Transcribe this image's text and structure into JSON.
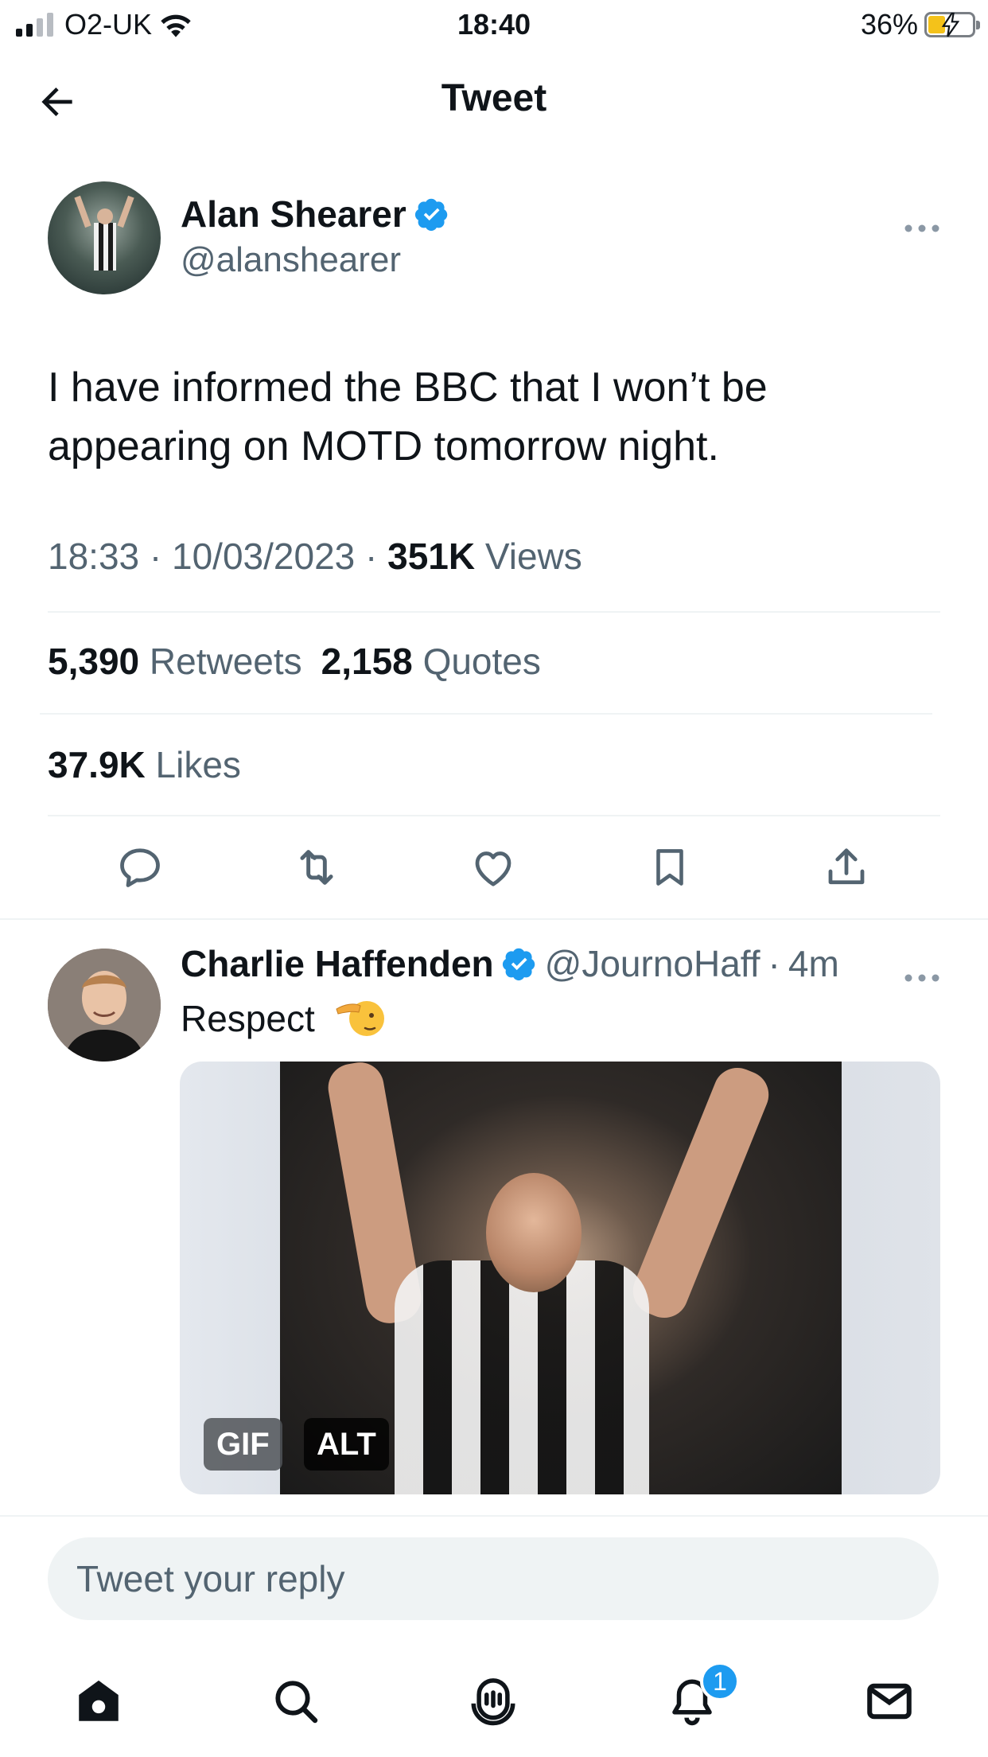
{
  "status_bar": {
    "carrier": "O2-UK",
    "time": "18:40",
    "battery_percent": "36%",
    "signal_bars_active": 2,
    "signal_bars_total": 4,
    "battery_level": 0.36,
    "charging": true
  },
  "header": {
    "title": "Tweet",
    "back_icon": "arrow-left-icon"
  },
  "tweet": {
    "author_name": "Alan Shearer",
    "author_handle": "@alanshearer",
    "verified": true,
    "text": "I have informed the BBC that I won’t be appearing on MOTD tomorrow night.",
    "time": "18:33",
    "date": "10/03/2023",
    "views_count": "351K",
    "views_label": "Views",
    "retweets_count": "5,390",
    "retweets_label": "Retweets",
    "quotes_count": "2,158",
    "quotes_label": "Quotes",
    "likes_count": "37.9K",
    "likes_label": "Likes",
    "separator": "·",
    "more_icon": "more-horizontal-icon"
  },
  "actions": [
    "reply-icon",
    "retweet-icon",
    "like-icon",
    "bookmark-icon",
    "share-icon"
  ],
  "reply": {
    "author_name": "Charlie Haffenden",
    "author_handle": "@JournoHaff",
    "time_ago": "4m",
    "separator": "·",
    "verified": true,
    "text": "Respect",
    "emoji": "saluting-face-emoji",
    "media": {
      "gif_label": "GIF",
      "alt_label": "ALT"
    }
  },
  "composer": {
    "placeholder": "Tweet your reply"
  },
  "tab_bar": {
    "tabs": [
      "home-icon",
      "search-icon",
      "spaces-icon",
      "notifications-icon",
      "messages-icon"
    ],
    "notifications_badge": "1"
  },
  "colors": {
    "accent": "#1d9bf0",
    "text_primary": "#0f1419",
    "text_secondary": "#536471",
    "divider": "#eff3f4"
  }
}
